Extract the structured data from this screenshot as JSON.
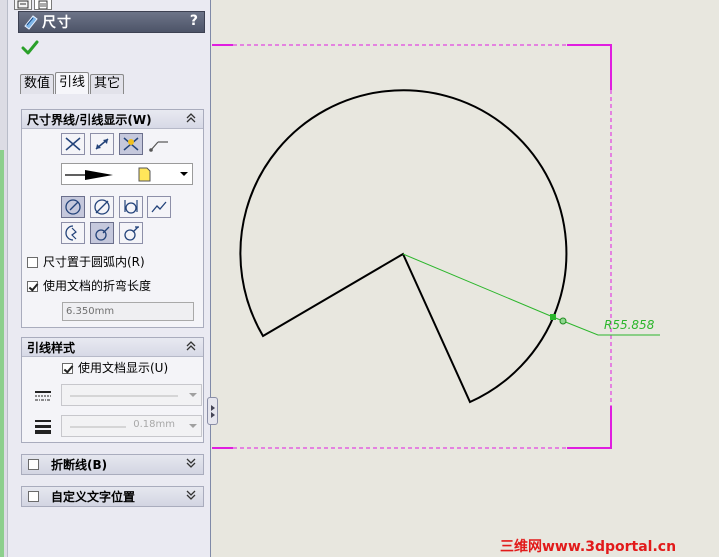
{
  "panel": {
    "title": "尺寸",
    "help": "?",
    "tabs": [
      {
        "label": "数值",
        "active": false
      },
      {
        "label": "引线",
        "active": true
      },
      {
        "label": "其它",
        "active": false
      }
    ],
    "group_leader_display": {
      "title": "尺寸界线/引线显示(W)",
      "option_inside_arc": {
        "label": "尺寸置于圆弧内(R)",
        "checked": false
      },
      "option_doc_bend": {
        "label": "使用文档的折弯长度",
        "checked": true
      },
      "bend_length": "6.350mm"
    },
    "group_leader_style": {
      "title": "引线样式",
      "option_doc_display": {
        "label": "使用文档显示(U)",
        "checked": true
      },
      "line_weight": "0.18mm"
    },
    "group_break_line": {
      "title": "折断线(B)",
      "checked": false
    },
    "group_custom_text": {
      "title": "自定义文字位置",
      "checked": false
    }
  },
  "drawing": {
    "dimension_label": "R55.858",
    "accent_colors": {
      "sketch": "#000000",
      "dimension": "#2cb62c",
      "frame": "#e01ee0"
    }
  },
  "watermark": "三维网www.3dportal.cn"
}
